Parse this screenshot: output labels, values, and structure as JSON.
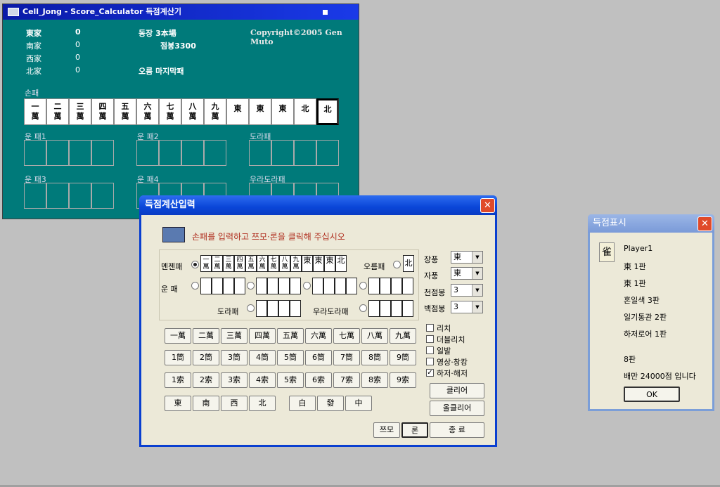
{
  "main_window": {
    "title": "Cell_Jong - Score_Calculator 득점계산기",
    "copyright": "Copyright©2005 Gen Muto",
    "players": [
      {
        "wind": "東家",
        "score": "0"
      },
      {
        "wind": "南家",
        "score": "0"
      },
      {
        "wind": "西家",
        "score": "0"
      },
      {
        "wind": "北家",
        "score": "0"
      }
    ],
    "round": "동장 3本場",
    "points": "점봉3300",
    "status": "오름 마지막패",
    "hand_label": "손패",
    "hand_tiles": [
      "一\n萬",
      "二\n萬",
      "三\n萬",
      "四\n萬",
      "五\n萬",
      "六\n萬",
      "七\n萬",
      "八\n萬",
      "九\n萬",
      "東",
      "東",
      "東",
      "北",
      "北"
    ],
    "meld_labels": [
      "운 패1",
      "운 패2",
      "도라패",
      "운 패3",
      "운 패4",
      "우라도라패"
    ]
  },
  "dialog": {
    "title": "득점계산입력",
    "close": "✕",
    "instruction": "손패를 입력하고 쯔모·론을 클릭해 주십시오",
    "menzen_label": "멘젠패",
    "menzen_tiles": [
      "一\n萬",
      "二\n萬",
      "三\n萬",
      "四\n萬",
      "五\n萬",
      "六\n萬",
      "七\n萬",
      "八\n萬",
      "九\n萬",
      "東",
      "東",
      "東",
      "北"
    ],
    "agari_label": "오름패",
    "agari_tile": "北",
    "meld_label": "운 패",
    "dora_label": "도라패",
    "uradora_label": "우라도라패",
    "round_wind_label": "장풍",
    "round_wind": "東",
    "seat_wind_label": "자풍",
    "seat_wind": "東",
    "honba_label": "천점봉",
    "honba": "3",
    "riichi_sticks_label": "백점봉",
    "riichi_sticks": "3",
    "man_buttons": [
      "一萬",
      "二萬",
      "三萬",
      "四萬",
      "五萬",
      "六萬",
      "七萬",
      "八萬",
      "九萬"
    ],
    "pin_buttons": [
      "1筒",
      "2筒",
      "3筒",
      "4筒",
      "5筒",
      "6筒",
      "7筒",
      "8筒",
      "9筒"
    ],
    "sou_buttons": [
      "1索",
      "2索",
      "3索",
      "4索",
      "5索",
      "6索",
      "7索",
      "8索",
      "9索"
    ],
    "wind_buttons": [
      "東",
      "南",
      "西",
      "北"
    ],
    "dragon_buttons": [
      "白",
      "發",
      "中"
    ],
    "checkboxes": [
      {
        "label": "리치",
        "checked": false
      },
      {
        "label": "더블리치",
        "checked": false
      },
      {
        "label": "일발",
        "checked": false
      },
      {
        "label": "영상·창캉",
        "checked": false
      },
      {
        "label": "하저·해저",
        "checked": true
      }
    ],
    "clear_button": "클리어",
    "all_clear_button": "올클리어",
    "tsumo_button": "쯔모",
    "ron_button": "론",
    "exit_button": "종 료"
  },
  "score_window": {
    "title": "득점표시",
    "close": "✕",
    "icon_glyph": "雀",
    "lines": [
      "Player1",
      "東 1판",
      "東 1판",
      "혼일색 3판",
      "일기통관 2판",
      "하저로어 1판"
    ],
    "total_han": "8판",
    "result": "배만 24000점 입니다",
    "ok_button": "OK"
  }
}
